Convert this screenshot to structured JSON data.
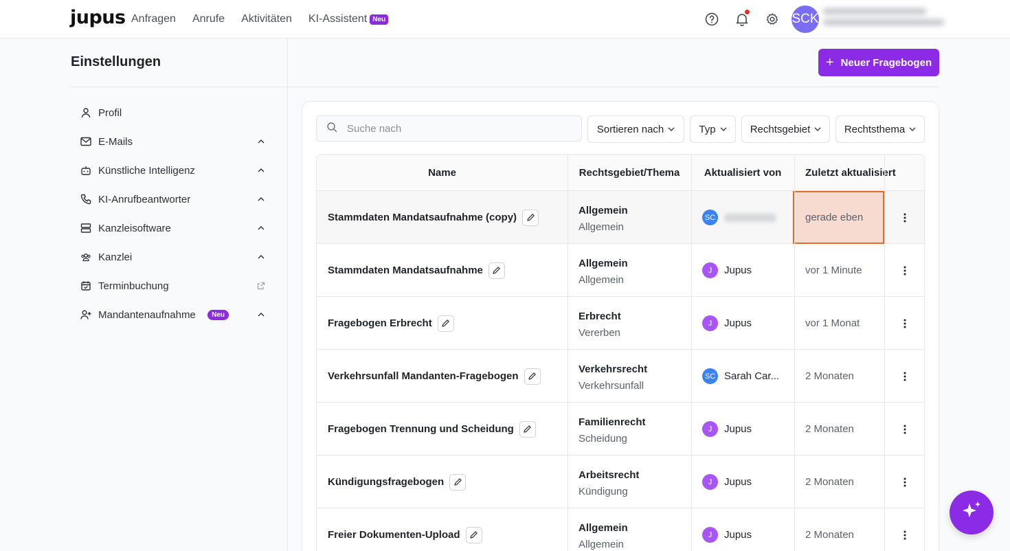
{
  "brand": {
    "logo": "jupus"
  },
  "nav": {
    "items": [
      {
        "label": "Anfragen"
      },
      {
        "label": "Anrufe"
      },
      {
        "label": "Aktivitäten"
      },
      {
        "label": "KI-Assistent",
        "badge": "Neu"
      }
    ]
  },
  "header_icons": [
    "help-icon",
    "bell-icon",
    "gear-icon"
  ],
  "user": {
    "initials": "SCK"
  },
  "settings": {
    "title": "Einstellungen",
    "items": [
      {
        "label": "Profil",
        "icon": "user-icon"
      },
      {
        "label": "E-Mails",
        "icon": "mail-icon"
      },
      {
        "label": "Künstliche Intelligenz",
        "icon": "robot-icon"
      },
      {
        "label": "KI-Anrufbeantworter",
        "icon": "phone-icon"
      },
      {
        "label": "Kanzleisoftware",
        "icon": "server-icon"
      },
      {
        "label": "Kanzlei",
        "icon": "team-icon"
      },
      {
        "label": "Terminbuchung",
        "icon": "calendar-icon"
      },
      {
        "label": "Mandantenaufnahme",
        "icon": "user-plus-icon",
        "badge": "Neu"
      }
    ]
  },
  "actions": {
    "new_questionnaire": "Neuer Fragebogen"
  },
  "search": {
    "placeholder": "Suche nach"
  },
  "filters": {
    "sort": "Sortieren nach",
    "type": "Typ",
    "area": "Rechtsgebiet",
    "topic": "Rechtsthema"
  },
  "table": {
    "headers": {
      "name": "Name",
      "area": "Rechtsgebiet/Thema",
      "updated_by": "Aktualisiert von",
      "last_updated": "Zuletzt aktualisiert"
    },
    "rows": [
      {
        "name": "Stammdaten Mandatsaufnahme (copy)",
        "area": "Allgemein",
        "topic": "Allgemein",
        "user_initials": "SC",
        "user_name": "",
        "updated": "gerade eben"
      },
      {
        "name": "Stammdaten Mandatsaufnahme",
        "area": "Allgemein",
        "topic": "Allgemein",
        "user_initials": "J",
        "user_name": "Jupus",
        "updated": "vor 1 Minute"
      },
      {
        "name": "Fragebogen Erbrecht",
        "area": "Erbrecht",
        "topic": "Vererben",
        "user_initials": "J",
        "user_name": "Jupus",
        "updated": "vor 1 Monat"
      },
      {
        "name": "Verkehrsunfall Mandanten-Fragebogen",
        "area": "Verkehrsrecht",
        "topic": "Verkehrsunfall",
        "user_initials": "SC",
        "user_name": "Sarah Car...",
        "updated": "2 Monaten"
      },
      {
        "name": "Fragebogen Trennung und Scheidung",
        "area": "Familienrecht",
        "topic": "Scheidung",
        "user_initials": "J",
        "user_name": "Jupus",
        "updated": "2 Monaten"
      },
      {
        "name": "Kündigungsfragebogen",
        "area": "Arbeitsrecht",
        "topic": "Kündigung",
        "user_initials": "J",
        "user_name": "Jupus",
        "updated": "2 Monaten"
      },
      {
        "name": "Freier Dokumenten-Upload",
        "area": "Allgemein",
        "topic": "Allgemein",
        "user_initials": "J",
        "user_name": "Jupus",
        "updated": "2 Monaten"
      }
    ]
  },
  "colors": {
    "accent": "#8b2be6",
    "highlight_border": "#e46a2c",
    "highlight_fill": "#f7dbd0"
  }
}
